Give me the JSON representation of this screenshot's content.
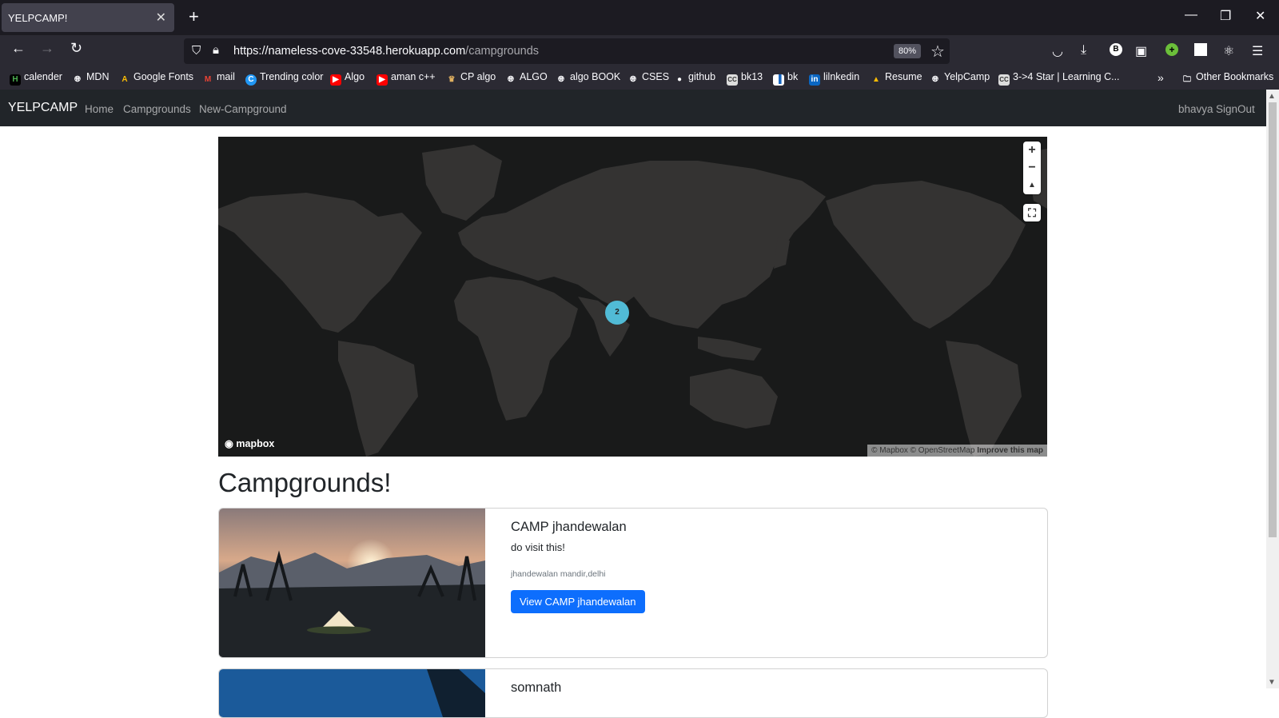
{
  "browser": {
    "tab_title": "YELPCAMP!",
    "url_host": "https://nameless-cove-33548.herokuapp.com",
    "url_path": "/campgrounds",
    "zoom": "80%",
    "bookmarks": [
      "calender",
      "MDN",
      "Google Fonts",
      "mail",
      "Trending color",
      "Algo",
      "aman c++",
      "CP algo",
      "ALGO",
      "algo BOOK",
      "CSES",
      "github",
      "bk13",
      "bk",
      "lilnkedin",
      "Resume",
      "YelpCamp",
      "3->4 Star | Learning C..."
    ],
    "other_bookmarks": "Other Bookmarks"
  },
  "site": {
    "brand": "YELPCAMP",
    "nav": [
      "Home",
      "Campgrounds",
      "New-Campground"
    ],
    "user": "bhavya",
    "signout": "SignOut"
  },
  "map": {
    "cluster_count": "2",
    "logo": "mapbox",
    "attribution": "© Mapbox © OpenStreetMap",
    "improve": "Improve this map"
  },
  "heading": "Campgrounds!",
  "campgrounds": [
    {
      "title": "CAMP jhandewalan",
      "description": "do visit this!",
      "location": "jhandewalan mandir,delhi",
      "button": "View CAMP jhandewalan"
    },
    {
      "title": "somnath"
    }
  ],
  "colors": {
    "navbar": "#212529",
    "button": "#0d6efd",
    "cluster": "#51bbd6",
    "map_bg": "#191a1a",
    "land": "#343332"
  }
}
